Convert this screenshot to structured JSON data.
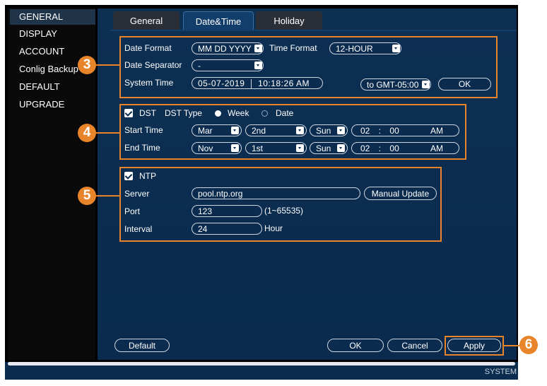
{
  "sidebar": {
    "items": [
      {
        "label": "GENERAL",
        "active": true
      },
      {
        "label": "DISPLAY"
      },
      {
        "label": "ACCOUNT"
      },
      {
        "label": "Conlig Backup"
      },
      {
        "label": "DEFAULT"
      },
      {
        "label": "UPGRADE"
      }
    ]
  },
  "tabs": [
    {
      "label": "General"
    },
    {
      "label": "Date&Time",
      "active": true
    },
    {
      "label": "Holiday"
    }
  ],
  "datetime": {
    "date_format_label": "Date Format",
    "date_format_value": "MM DD YYYY",
    "time_format_label": "Time Format",
    "time_format_value": "12-HOUR",
    "date_separator_label": "Date Separator",
    "date_separator_value": "-",
    "system_time_label": "System Time",
    "system_date_value": "05-07-2019",
    "system_time_value": "10:18:26 AM",
    "timezone_value": "to GMT-05:00",
    "ok_label": "OK"
  },
  "dst": {
    "enabled": true,
    "dst_label": "DST",
    "dst_type_label": "DST Type",
    "week_label": "Week",
    "date_label": "Date",
    "selected_type": "Week",
    "start_label": "Start Time",
    "start": {
      "month": "Mar",
      "week": "2nd",
      "day": "Sun",
      "hour": "02",
      "minute": "00",
      "ampm": "AM",
      "sep": ":"
    },
    "end_label": "End Time",
    "end": {
      "month": "Nov",
      "week": "1st",
      "day": "Sun",
      "hour": "02",
      "minute": "00",
      "ampm": "AM",
      "sep": ":"
    }
  },
  "ntp": {
    "enabled": true,
    "ntp_label": "NTP",
    "server_label": "Server",
    "server_value": "pool.ntp.org",
    "manual_update_label": "Manual Update",
    "port_label": "Port",
    "port_value": "123",
    "port_range": "(1~65535)",
    "interval_label": "Interval",
    "interval_value": "24",
    "interval_unit": "Hour"
  },
  "footer": {
    "default_label": "Default",
    "ok_label": "OK",
    "cancel_label": "Cancel",
    "apply_label": "Apply",
    "status_label": "SYSTEM"
  },
  "callouts": [
    "3",
    "4",
    "5",
    "6"
  ],
  "colors": {
    "accent_orange": "#e8852b",
    "panel_blue": "#0b2c4f",
    "active_tab": "#123e6c"
  }
}
